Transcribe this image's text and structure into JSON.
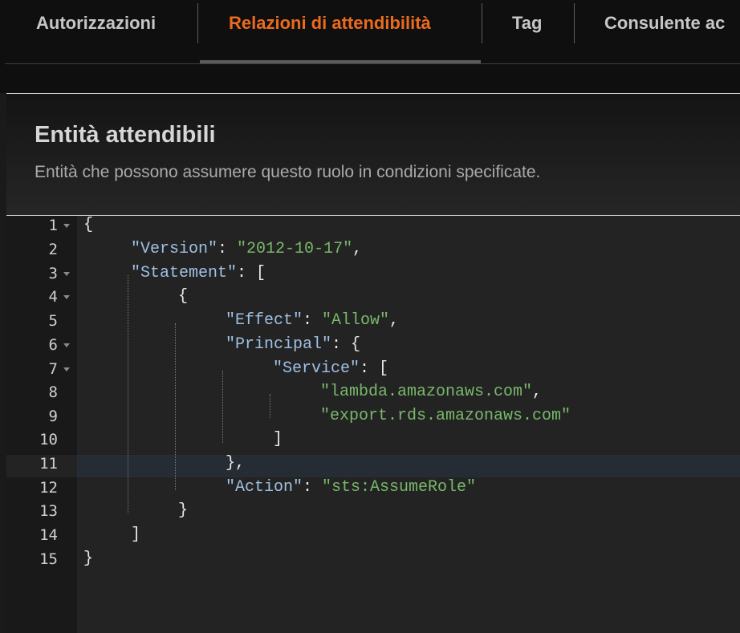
{
  "tabs": [
    {
      "label": "Autorizzazioni",
      "active": false
    },
    {
      "label": "Relazioni di attendibilità",
      "active": true
    },
    {
      "label": "Tag",
      "active": false
    },
    {
      "label": "Consulente ac",
      "active": false
    }
  ],
  "panel": {
    "title": "Entità attendibili",
    "description": "Entità che possono assumere questo ruolo in condizioni specificate."
  },
  "editor": {
    "active_line": 11,
    "folded_lines_markers": [
      1,
      3,
      4,
      6,
      7
    ],
    "lines": [
      {
        "n": "1",
        "text": "{"
      },
      {
        "n": "2",
        "text": "\"Version\": \"2012-10-17\","
      },
      {
        "n": "3",
        "text": "\"Statement\": ["
      },
      {
        "n": "4",
        "text": "{"
      },
      {
        "n": "5",
        "text": "\"Effect\": \"Allow\","
      },
      {
        "n": "6",
        "text": "\"Principal\": {"
      },
      {
        "n": "7",
        "text": "\"Service\": ["
      },
      {
        "n": "8",
        "text": "\"lambda.amazonaws.com\","
      },
      {
        "n": "9",
        "text": "\"export.rds.amazonaws.com\""
      },
      {
        "n": "10",
        "text": "]"
      },
      {
        "n": "11",
        "text": "},"
      },
      {
        "n": "12",
        "text": "\"Action\": \"sts:AssumeRole\""
      },
      {
        "n": "13",
        "text": "}"
      },
      {
        "n": "14",
        "text": "]"
      },
      {
        "n": "15",
        "text": "}"
      }
    ]
  },
  "colors": {
    "active_tab": "#ea6b1e",
    "json_key": "#9ec1e4",
    "json_string": "#78b86a",
    "active_line_bg": "#262c33"
  }
}
